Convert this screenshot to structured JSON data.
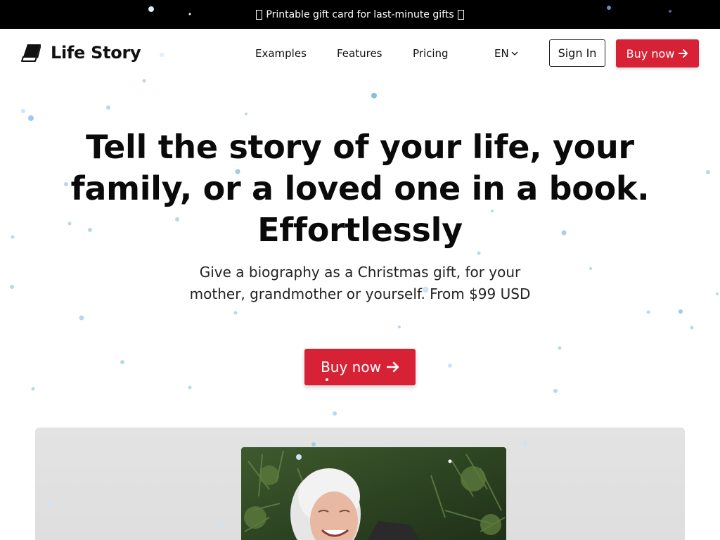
{
  "announcement": {
    "text": "Printable gift card for last-minute gifts"
  },
  "header": {
    "brand": "Life Story",
    "nav": {
      "examples": "Examples",
      "features": "Features",
      "pricing": "Pricing"
    },
    "language": "EN",
    "sign_in": "Sign In",
    "buy_now": "Buy now"
  },
  "hero": {
    "title": "Tell the story of your life, your family, or a loved one in a book. Effortlessly",
    "subtitle": "Give a biography as a Christmas gift, for your mother, grandmother or yourself. From $99 USD",
    "cta": "Buy now"
  },
  "colors": {
    "accent": "#d62234",
    "announcement_bg": "#000000",
    "snow": "#9ecbe8"
  },
  "icons": {
    "logo": "book-icon",
    "language": "chevron-down-icon",
    "cta": "arrow-right-icon",
    "gift": "gift-icon"
  }
}
